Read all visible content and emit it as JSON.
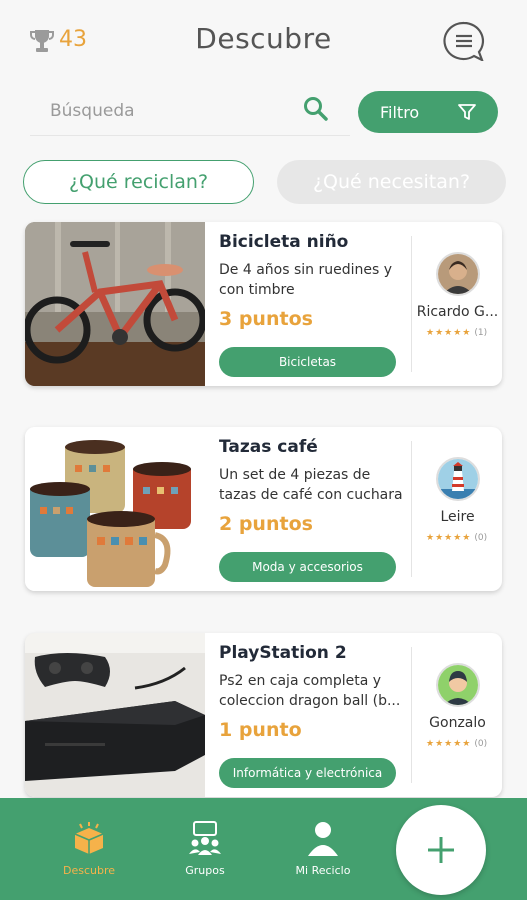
{
  "header": {
    "points": "43",
    "title": "Descubre"
  },
  "search": {
    "placeholder": "Búsqueda",
    "filter_label": "Filtro"
  },
  "toggles": {
    "recycle_label": "¿Qué reciclan?",
    "need_label": "¿Qué necesitan?"
  },
  "items": [
    {
      "title": "Bicicleta niño",
      "description": "De 4 años sin ruedines y con timbre",
      "points": "3 puntos",
      "category": "Bicicletas",
      "user": "Ricardo G...",
      "rating_count": "(1)"
    },
    {
      "title": "Tazas café",
      "description": "Un set de 4 piezas de tazas de café con cuchara",
      "points": "2 puntos",
      "category": "Moda y accesorios",
      "user": "Leire",
      "rating_count": "(0)"
    },
    {
      "title": "PlayStation 2",
      "description": "Ps2 en caja completa y coleccion dragon ball (b...",
      "points": "1 punto",
      "category": "Informática y electrónica",
      "user": "Gonzalo",
      "rating_count": "(0)"
    }
  ],
  "nav": {
    "discover": "Descubre",
    "groups": "Grupos",
    "my_recycle": "Mi Reciclo"
  },
  "colors": {
    "brand_green": "#44a06f",
    "accent_orange": "#e8a33c"
  }
}
